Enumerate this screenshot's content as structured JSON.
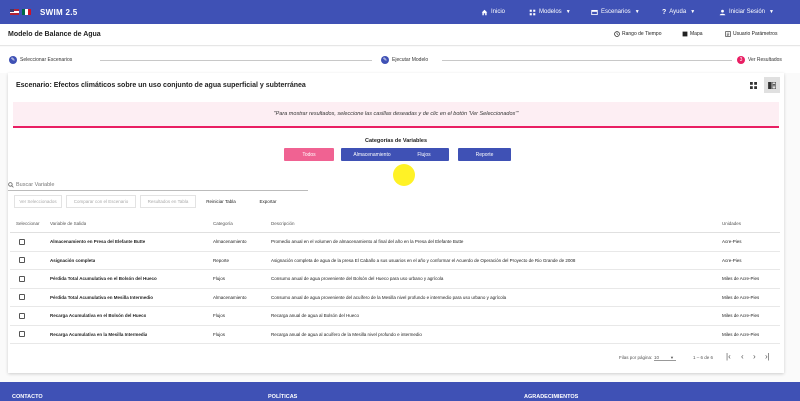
{
  "app": {
    "title": "SWIM 2.5"
  },
  "nav": {
    "home": "Inicio",
    "models": "Modelos",
    "scenarios": "Escenarios",
    "help": "Ayuda",
    "login": "Iniciar Sesión"
  },
  "page": {
    "title": "Modelo de Balance de Agua",
    "time_range": "Rango de Tiempo",
    "map": "Mapa",
    "params": "Usuario Parámetros"
  },
  "steps": [
    {
      "label": "Seleccionar Escenarios",
      "icon": "pencil-icon"
    },
    {
      "label": "Ejecutar Modelo",
      "icon": "pencil-icon"
    },
    {
      "label": "Ver Resultados",
      "number": "3"
    }
  ],
  "scenario": {
    "title": "Escenario: Efectos climáticos sobre un uso conjunto de agua superficial y subterránea",
    "notice": "\"Para mostrar resultados, seleccione las casillas deseadas y de clic en el botón 'Ver Seleccionados'\""
  },
  "categories": {
    "title": "Categorías de Variables",
    "buttons": [
      "Todos",
      "Almacenamiento",
      "Flujos",
      "Reporte"
    ]
  },
  "search": {
    "label": "Buscar Variable"
  },
  "table_buttons": [
    "Ver Seleccionados",
    "Comparar con el Escenario",
    "Resultados en Tabla",
    "Reiniciar Tabla",
    "Exportar"
  ],
  "table": {
    "headers": [
      "Seleccionar",
      "Variable de Salida",
      "Categoría",
      "Descripción",
      "Unidades"
    ],
    "rows": [
      [
        "Almacenamiento en Presa del Elefante Butte",
        "Almacenamiento",
        "Promedio anual en el volumen de almacenamiento al final del año en la Presa del Elefante Butte",
        "Acre-Pies"
      ],
      [
        "Asignación completa",
        "Reporte",
        "Asignación completa de agua de la presa El Caballo a sus usuarios en el año y conformar el Acuerdo de Operación del Proyecto de Rio Grande de 2008",
        "Acre-Pies"
      ],
      [
        "Pérdida Total Acumulativa en el Bolsón del Hueco",
        "Flujos",
        "Consumo anual de agua proveniente del Bolsón del Hueco para uso urbano y agrícola",
        "Miles de Acre-Pies"
      ],
      [
        "Pérdida Total Acumulativa en Mesilla Intermedio",
        "Almacenamiento",
        "Consumo anual de agua proveniente del acuífero de la Mesilla nivel profundo e intermedio para uso urbano y agrícola",
        "Miles de Acre-Pies"
      ],
      [
        "Recarga Acumulativa en el Bolsón del Hueco",
        "Flujos",
        "Recarga anual de agua al Bolsón del Hueco",
        "Miles de Acre-Pies"
      ],
      [
        "Recarga Acumulativa en la Mesilla Intermedia",
        "Flujos",
        "Recarga anual de agua al acuífero de la Mesilla nivel profundo e intermedio",
        "Miles de Acre-Pies"
      ]
    ]
  },
  "pager": {
    "rows_per_page_label": "Filas por página:",
    "rows_per_page": "10",
    "range": "1 – 6 de 6"
  },
  "footer": [
    "CONTACTO",
    "POLÍTICAS",
    "AGRADECIMIENTOS"
  ],
  "colors": {
    "primary": "#3f51b5",
    "accent": "#e91e63"
  }
}
